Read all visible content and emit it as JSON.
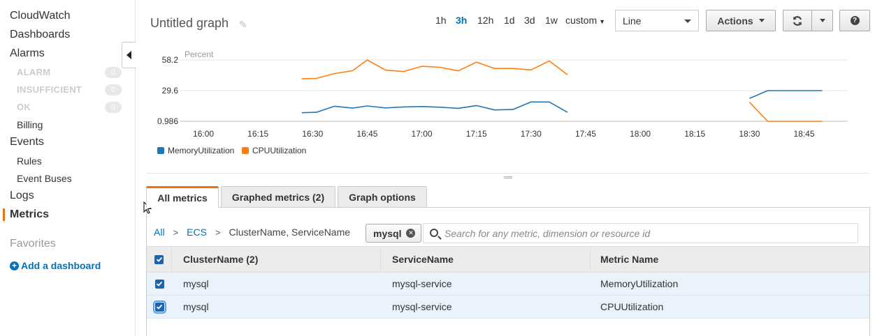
{
  "sidebar": {
    "items": [
      {
        "label": "CloudWatch"
      },
      {
        "label": "Dashboards"
      },
      {
        "label": "Alarms"
      },
      {
        "label": "ALARM",
        "badge": "0"
      },
      {
        "label": "INSUFFICIENT",
        "badge": "0"
      },
      {
        "label": "OK",
        "badge": "0"
      },
      {
        "label": "Billing"
      },
      {
        "label": "Events"
      },
      {
        "label": "Rules"
      },
      {
        "label": "Event Buses"
      },
      {
        "label": "Logs"
      },
      {
        "label": "Metrics",
        "active": true
      }
    ],
    "favorites_label": "Favorites",
    "add_dashboard_label": "Add a dashboard"
  },
  "header": {
    "graph_title": "Untitled graph",
    "time_ranges": [
      "1h",
      "3h",
      "12h",
      "1d",
      "3d",
      "1w",
      "custom"
    ],
    "active_range": "3h",
    "chart_type": "Line",
    "actions_label": "Actions"
  },
  "chart_data": {
    "type": "line",
    "ylabel": "Percent",
    "y_ticks": [
      "58.2",
      "29.6",
      "0.986"
    ],
    "ylim": [
      0.986,
      58.2
    ],
    "x_ticks": [
      "16:00",
      "16:15",
      "16:30",
      "16:45",
      "17:00",
      "17:15",
      "17:30",
      "17:45",
      "18:00",
      "18:15",
      "18:30",
      "18:45"
    ],
    "xlim": [
      "15:55",
      "18:57"
    ],
    "grid": "horizontal",
    "legend": "bottom-left",
    "series": [
      {
        "name": "MemoryUtilization",
        "color": "#1f77b4",
        "segments": [
          [
            [
              "16:27",
              9.0
            ],
            [
              "16:31",
              9.4
            ],
            [
              "16:36",
              15.0
            ],
            [
              "16:41",
              13.3
            ],
            [
              "16:45",
              15.3
            ],
            [
              "16:50",
              13.5
            ],
            [
              "16:55",
              14.4
            ],
            [
              "17:00",
              14.8
            ],
            [
              "17:05",
              14.1
            ],
            [
              "17:10",
              13.1
            ],
            [
              "17:15",
              15.7
            ],
            [
              "17:20",
              11.6
            ],
            [
              "17:25",
              12.0
            ],
            [
              "17:30",
              19.0
            ],
            [
              "17:35",
              19.0
            ],
            [
              "17:40",
              9.4
            ]
          ],
          [
            [
              "18:30",
              22.3
            ],
            [
              "18:35",
              29.6
            ],
            [
              "18:40",
              29.6
            ],
            [
              "18:45",
              29.6
            ],
            [
              "18:50",
              29.6
            ]
          ]
        ]
      },
      {
        "name": "CPUUtilization",
        "color": "#ff7f0e",
        "segments": [
          [
            [
              "16:27",
              40.6
            ],
            [
              "16:31",
              41.0
            ],
            [
              "16:36",
              45.5
            ],
            [
              "16:41",
              48.2
            ],
            [
              "16:45",
              58.2
            ],
            [
              "16:50",
              48.7
            ],
            [
              "16:55",
              47.4
            ],
            [
              "17:00",
              52.3
            ],
            [
              "17:05",
              51.4
            ],
            [
              "17:10",
              48.0
            ],
            [
              "17:15",
              56.2
            ],
            [
              "17:20",
              50.3
            ],
            [
              "17:25",
              50.3
            ],
            [
              "17:30",
              48.9
            ],
            [
              "17:35",
              57.3
            ],
            [
              "17:40",
              44.4
            ]
          ],
          [
            [
              "18:30",
              18.8
            ],
            [
              "18:35",
              0.986
            ],
            [
              "18:40",
              0.986
            ],
            [
              "18:45",
              0.986
            ],
            [
              "18:50",
              0.986
            ]
          ]
        ]
      }
    ]
  },
  "tabs": [
    {
      "label": "All metrics",
      "active": true
    },
    {
      "label": "Graphed metrics (2)"
    },
    {
      "label": "Graph options"
    }
  ],
  "breadcrumb": {
    "items": [
      "All",
      "ECS",
      "ClusterName, ServiceName"
    ],
    "separator": ">"
  },
  "search": {
    "token": "mysql",
    "placeholder": "Search for any metric, dimension or resource id",
    "value": ""
  },
  "table": {
    "columns": [
      "ClusterName (2)",
      "ServiceName",
      "Metric Name"
    ],
    "rows": [
      {
        "cluster": "mysql",
        "service": "mysql-service",
        "metric": "MemoryUtilization",
        "checked": true
      },
      {
        "cluster": "mysql",
        "service": "mysql-service",
        "metric": "CPUUtilization",
        "checked": true
      }
    ]
  }
}
